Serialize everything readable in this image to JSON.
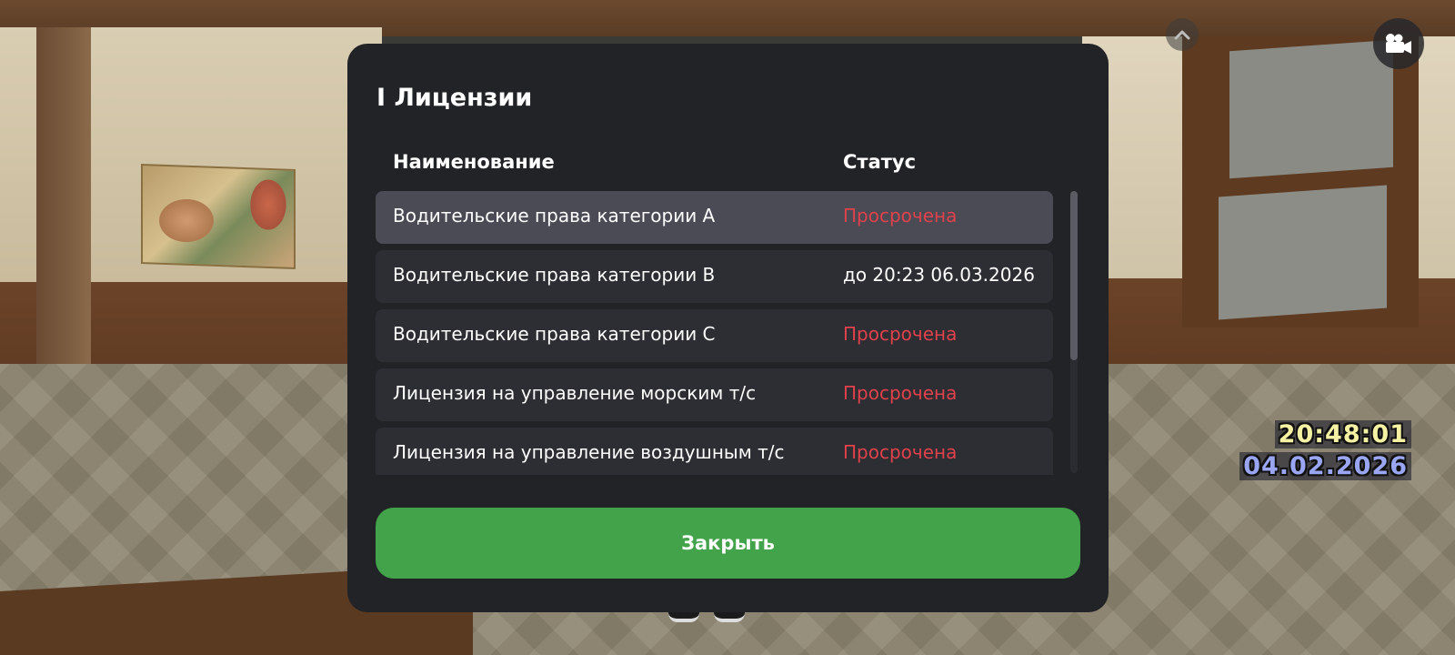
{
  "modal": {
    "title": "I Лицензии",
    "columns": {
      "name": "Наименование",
      "status": "Статус"
    },
    "rows": [
      {
        "name": "Водительские права категории A",
        "status": "Просрочена",
        "state": "expired",
        "selected": true
      },
      {
        "name": "Водительские права категории B",
        "status": "до 20:23 06.03.2026",
        "state": "valid",
        "selected": false
      },
      {
        "name": "Водительские права категории C",
        "status": "Просрочена",
        "state": "expired",
        "selected": false
      },
      {
        "name": "Лицензия на управление морским т/с",
        "status": "Просрочена",
        "state": "expired",
        "selected": false
      },
      {
        "name": "Лицензия на управление воздушным т/с",
        "status": "Просрочена",
        "state": "expired",
        "selected": false
      }
    ],
    "close_label": "Закрыть"
  },
  "hud": {
    "time": "20:48:01",
    "date": "04.02.2026",
    "camera_icon": "video-camera-icon",
    "collapse_icon": "chevron-up-icon"
  },
  "colors": {
    "expired": "#e0414b",
    "close_button": "#43a34a",
    "panel": "#222327",
    "row": "#2d2e33",
    "row_selected": "#4a4b55"
  }
}
